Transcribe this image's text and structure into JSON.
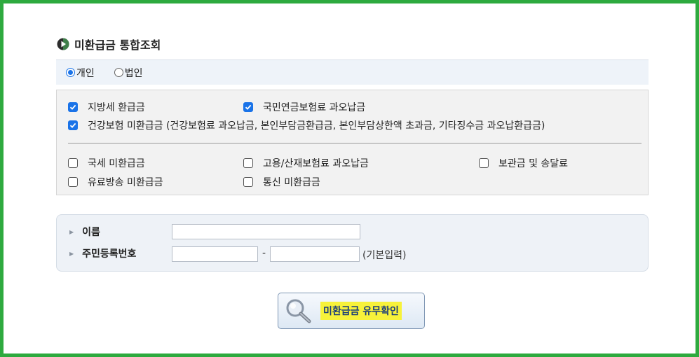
{
  "title": "미환급금 통합조회",
  "person_type": {
    "options": [
      {
        "label": "개인",
        "selected": true
      },
      {
        "label": "법인",
        "selected": false
      }
    ]
  },
  "checkboxes": {
    "group1": [
      {
        "label": "지방세 환급금",
        "checked": true
      },
      {
        "label": "국민연금보험료 과오납금",
        "checked": true
      },
      {
        "label": "건강보험 미환급금 (건강보험료 과오납금, 본인부담금환급금, 본인부담상한액 초과금, 기타징수금 과오납환급금)",
        "checked": true
      }
    ],
    "group2": [
      {
        "label": "국세 미환급금",
        "checked": false
      },
      {
        "label": "고용/산재보험료 과오납금",
        "checked": false
      },
      {
        "label": "보관금 및 송달료",
        "checked": false
      },
      {
        "label": "유료방송 미환급금",
        "checked": false
      },
      {
        "label": "통신 미환급금",
        "checked": false
      }
    ]
  },
  "form": {
    "name_label": "이름",
    "name_value": "",
    "rrn_label": "주민등록번호",
    "rrn_front": "",
    "rrn_separator": "-",
    "rrn_back": "",
    "rrn_hint": "(기본입력)"
  },
  "submit": {
    "label": "미환급금 유무확인",
    "highlight_color": "#f7f23a"
  },
  "colors": {
    "frame_border": "#2eaa3f",
    "accent": "#1a73e8"
  }
}
